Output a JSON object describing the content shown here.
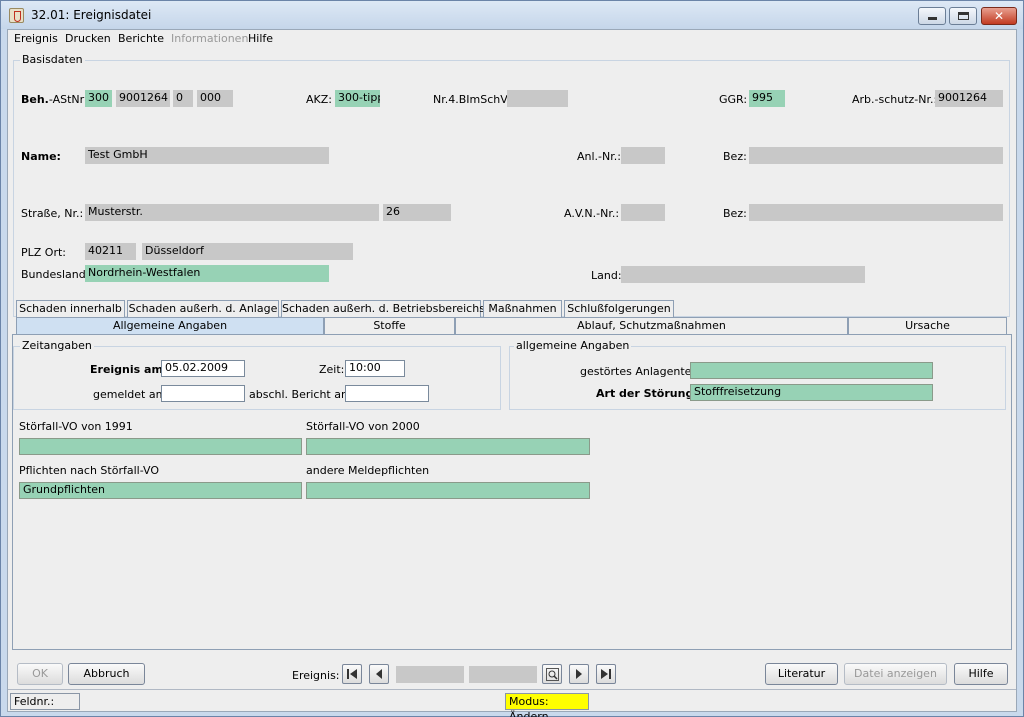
{
  "window": {
    "title": "32.01: Ereignisdatei",
    "close_glyph": "✕"
  },
  "menu": [
    "Ereignis",
    "Drucken",
    "Berichte",
    "Informationen",
    "Hilfe"
  ],
  "basisdaten": {
    "legend": "Basisdaten",
    "beh_label_bold": "Beh.",
    "beh_label_rest": "-AStNr:",
    "beh_1": "300",
    "beh_2": "9001264",
    "beh_3": "0",
    "beh_4": "000",
    "akz_label": "AKZ:",
    "akz_value": "300-tipp",
    "nr4_label": "Nr.4.BImSchV:",
    "nr4_value": "",
    "ggr_label": "GGR:",
    "ggr_value": "995",
    "arbschutz_label": "Arb.-schutz-Nr.:",
    "arbschutz_value": "9001264",
    "name_label": "Name:",
    "name_value": "Test GmbH",
    "anl_label": "Anl.-Nr.:",
    "anl_value": "",
    "bez1_label": "Bez:",
    "bez1_value": "",
    "strasse_label": "Straße, Nr.:",
    "strasse_value": "Musterstr.",
    "hausnr_value": "26",
    "avn_label": "A.V.N.-Nr.:",
    "avn_value": "",
    "bez2_label": "Bez:",
    "bez2_value": "",
    "plz_label": "PLZ Ort:",
    "plz_value": "40211",
    "ort_value": "Düsseldorf",
    "bundesland_label": "Bundesland:",
    "bundesland_value": "Nordrhein-Westfalen",
    "land_label": "Land:",
    "land_value": ""
  },
  "tabs_row1": [
    "Schaden innerhalb",
    "Schaden außerh. d. Anlage",
    "Schaden außerh. d. Betriebsbereichs",
    "Maßnahmen",
    "Schlußfolgerungen"
  ],
  "tabs_row2": [
    "Allgemeine Angaben",
    "Stoffe",
    "Ablauf, Schutzmaßnahmen",
    "Ursache"
  ],
  "zeitangaben": {
    "legend": "Zeitangaben",
    "ereignis_label": "Ereignis am:",
    "ereignis_value": "05.02.2009",
    "zeit_label": "Zeit:",
    "zeit_value": "10:00",
    "gemeldet_label": "gemeldet am:",
    "gemeldet_value": "",
    "bericht_label": "abschl. Bericht am:",
    "bericht_value": ""
  },
  "allgemein": {
    "legend": "allgemeine Angaben",
    "anlagenteil_label": "gestörtes Anlagenteil:",
    "anlagenteil_value": "",
    "stoerung_label": "Art der Störung:",
    "stoerung_value": "Stofffreisetzung"
  },
  "vo": {
    "vo1991_label": "Störfall-VO von 1991",
    "vo1991_value": "",
    "vo2000_label": "Störfall-VO von 2000",
    "vo2000_value": "",
    "pflichten_label": "Pflichten nach Störfall-VO",
    "pflichten_value": "Grundpflichten",
    "andere_label": "andere Meldepflichten",
    "andere_value": ""
  },
  "buttons": {
    "ok": "OK",
    "abbruch": "Abbruch",
    "ereignis_label": "Ereignis:",
    "nav_field1": "",
    "nav_field2": "",
    "literatur": "Literatur",
    "datei_anzeigen": "Datei anzeigen",
    "hilfe": "Hilfe"
  },
  "status": {
    "feldnr_label": "Feldnr.:",
    "modus": "Modus: Ändern",
    "modus_color": "#ffff00"
  }
}
